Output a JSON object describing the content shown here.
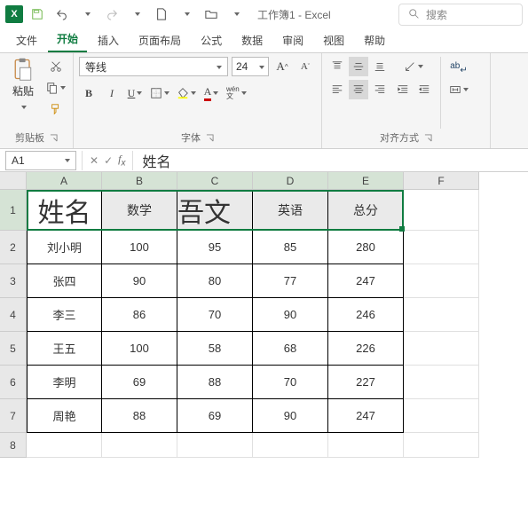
{
  "app": {
    "title": "工作簿1 - Excel"
  },
  "search": {
    "placeholder": "搜索"
  },
  "tabs": [
    "文件",
    "开始",
    "插入",
    "页面布局",
    "公式",
    "数据",
    "审阅",
    "视图",
    "帮助"
  ],
  "active_tab": 1,
  "ribbon": {
    "clipboard": {
      "paste": "粘贴",
      "label": "剪贴板"
    },
    "font": {
      "family": "等线",
      "size": "24",
      "label": "字体",
      "ruby": "wén"
    },
    "align": {
      "label": "对齐方式",
      "wrap": "ab"
    }
  },
  "formula": {
    "cell_ref": "A1",
    "value": "姓名"
  },
  "columns": [
    "A",
    "B",
    "C",
    "D",
    "E",
    "F"
  ],
  "row_nums": [
    "1",
    "2",
    "3",
    "4",
    "5",
    "6",
    "7",
    "8"
  ],
  "table": {
    "headers": {
      "a": "姓名",
      "b": "数学",
      "c": "吾文",
      "d": "英语",
      "e": "总分"
    },
    "rows": [
      {
        "name": "刘小明",
        "math": "100",
        "chinese": "95",
        "english": "85",
        "total": "280"
      },
      {
        "name": "张四",
        "math": "90",
        "chinese": "80",
        "english": "77",
        "total": "247"
      },
      {
        "name": "李三",
        "math": "86",
        "chinese": "70",
        "english": "90",
        "total": "246"
      },
      {
        "name": "王五",
        "math": "100",
        "chinese": "58",
        "english": "68",
        "total": "226"
      },
      {
        "name": "李明",
        "math": "69",
        "chinese": "88",
        "english": "70",
        "total": "227"
      },
      {
        "name": "周艳",
        "math": "88",
        "chinese": "69",
        "english": "90",
        "total": "247"
      }
    ]
  }
}
